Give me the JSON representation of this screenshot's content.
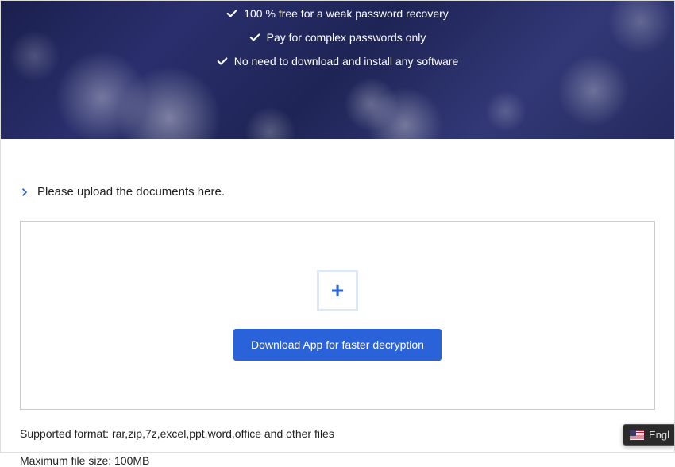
{
  "hero": {
    "features": [
      "100 % free for a weak password recovery",
      "Pay for complex passwords only",
      "No need to download and install any software"
    ]
  },
  "upload": {
    "prompt": "Please upload the documents here.",
    "download_button": "Download App for faster decryption"
  },
  "info": {
    "supported_format": "Supported format: rar,zip,7z,excel,ppt,word,office and other files",
    "max_size": "Maximum file size: 100MB"
  },
  "lang": {
    "label": "Engl"
  }
}
